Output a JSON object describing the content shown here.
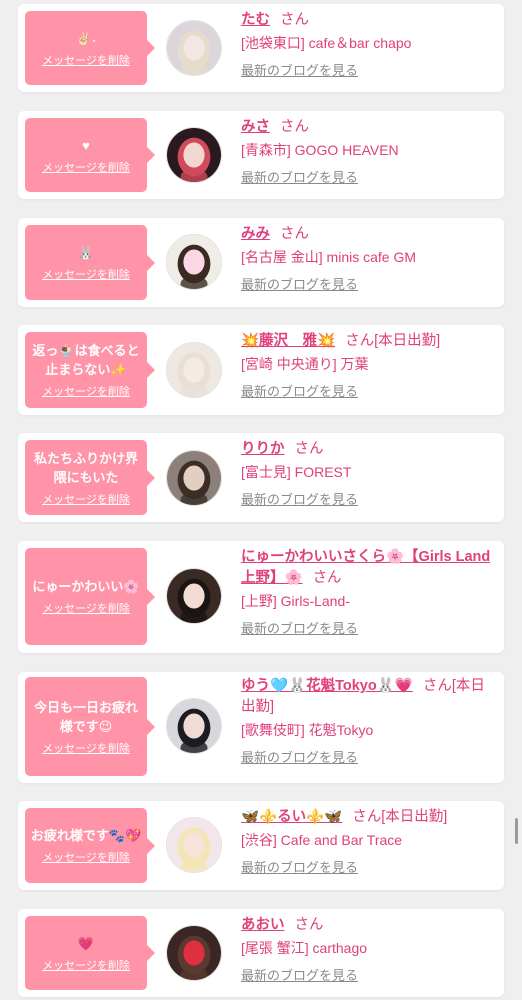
{
  "colors": {
    "accent": "#e0407c",
    "bubble": "#ff93a7",
    "link_gray": "#8a8a8a",
    "background": "#efefef"
  },
  "entries": [
    {
      "message": "✌🏻˖",
      "delete_label": "メッセージを削除",
      "name": "たむ",
      "honorific": "さん",
      "shop": "[池袋東口] cafe＆bar chapo",
      "blog_link": "最新のブログを見る",
      "avatar": {
        "icon": "avatar-photo",
        "bg": "#dcd6dc",
        "hair": "#e6dccb",
        "face": "#f4e6e2"
      }
    },
    {
      "message": "♥",
      "delete_label": "メッセージを削除",
      "name": "みさ",
      "honorific": "さん",
      "shop": "[青森市] GOGO HEAVEN",
      "blog_link": "最新のブログを見る",
      "avatar": {
        "icon": "avatar-photo",
        "bg": "#2a1a20",
        "hair": "#d04a5a",
        "face": "#f2d6d0"
      }
    },
    {
      "message": "🐰",
      "delete_label": "メッセージを削除",
      "name": "みみ",
      "honorific": "さん",
      "shop": "[名古屋 金山] minis cafe GM",
      "blog_link": "最新のブログを見る",
      "avatar": {
        "icon": "avatar-photo",
        "bg": "#f0ece6",
        "hair": "#3a2a22",
        "face": "#fbd6e4"
      }
    },
    {
      "message": "返っ🍨は食べると止まらない✨",
      "delete_label": "メッセージを削除",
      "name": "💥藤沢　雅💥",
      "honorific": "さん[本日出勤]",
      "shop": "[宮崎 中央通り] 万葉",
      "blog_link": "最新のブログを見る",
      "avatar": {
        "icon": "avatar-photo",
        "bg": "#efe8e0",
        "hair": "#e8dfd6",
        "face": "#f4ece4"
      }
    },
    {
      "message": "私たちふりかけ界隈にもいた",
      "delete_label": "メッセージを削除",
      "name": "りりか",
      "honorific": "さん",
      "shop": "[富士見] FOREST",
      "blog_link": "最新のブログを見る",
      "avatar": {
        "icon": "avatar-photo",
        "bg": "#8c8078",
        "hair": "#3a2e26",
        "face": "#e2cfc2"
      }
    },
    {
      "message": "にゅーかわいい🌸",
      "delete_label": "メッセージを削除",
      "name": "にゅーかわいいさくら🌸【Girls Land 上野】🌸",
      "honorific": "さん",
      "shop": "[上野] Girls-Land-",
      "blog_link": "最新のブログを見る",
      "avatar": {
        "icon": "avatar-photo",
        "bg": "#3a2a24",
        "hair": "#1a1414",
        "face": "#f2dcd2"
      }
    },
    {
      "message": "今日も一日お疲れ様です😉",
      "delete_label": "メッセージを削除",
      "name": "ゆう🩵🐰花魁Tokyo🐰💗",
      "honorific": "さん[本日出勤]",
      "shop": "[歌舞伎町] 花魁Tokyo",
      "blog_link": "最新のブログを見る",
      "avatar": {
        "icon": "avatar-photo",
        "bg": "#d8d8dc",
        "hair": "#1c1c22",
        "face": "#f0dcd4"
      }
    },
    {
      "message": "お疲れ様です🐾💖",
      "delete_label": "メッセージを削除",
      "name": "🦋⚜️るい⚜️🦋",
      "honorific": "さん[本日出勤]",
      "shop": "[渋谷] Cafe and Bar Trace",
      "blog_link": "最新のブログを見る",
      "avatar": {
        "icon": "avatar-photo",
        "bg": "#f2e6ea",
        "hair": "#f4e6b4",
        "face": "#f8e2dc"
      }
    },
    {
      "message": "💗",
      "delete_label": "メッセージを削除",
      "name": "あおい",
      "honorific": "さん",
      "shop": "[尾張 蟹江] carthago",
      "blog_link": "最新のブログを見る",
      "avatar": {
        "icon": "avatar-photo",
        "bg": "#3a2622",
        "hair": "#5a3a30",
        "face": "#e03040"
      }
    }
  ]
}
